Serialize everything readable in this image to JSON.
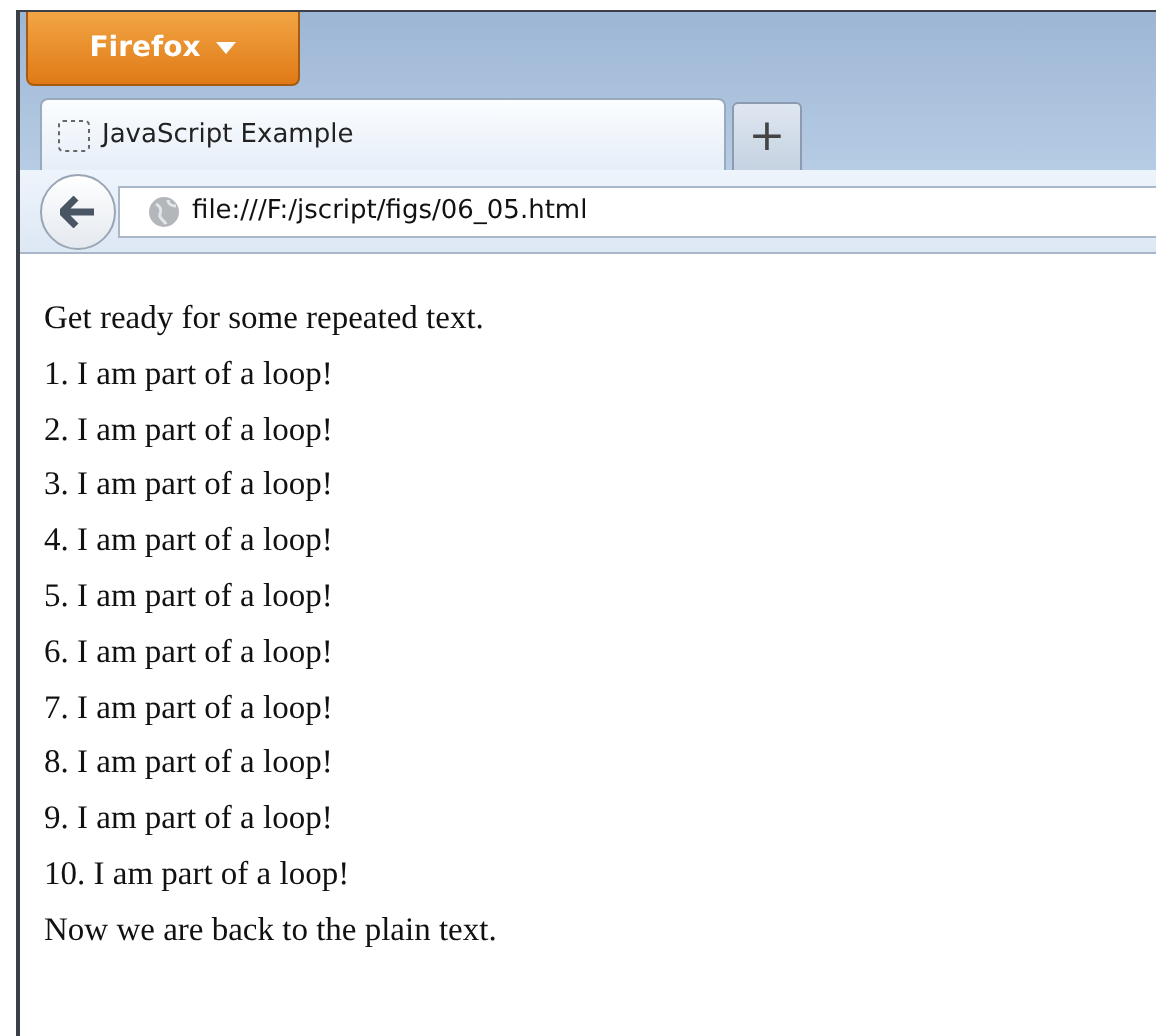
{
  "window": {
    "menu_button": {
      "label": "Firefox"
    }
  },
  "tabs": [
    {
      "title": "JavaScript Example",
      "selected": true
    }
  ],
  "new_tab_button": {
    "label": "+"
  },
  "address_bar": {
    "url": "file:///F:/jscript/figs/06_05.html"
  },
  "content": {
    "lines": [
      "Get ready for some repeated text.",
      "1. I am part of a loop!",
      "2. I am part of a loop!",
      "3. I am part of a loop!",
      "4. I am part of a loop!",
      "5. I am part of a loop!",
      "6. I am part of a loop!",
      "7. I am part of a loop!",
      "8. I am part of a loop!",
      "9. I am part of a loop!",
      "10. I am part of a loop!",
      "Now we are back to the plain text."
    ]
  }
}
